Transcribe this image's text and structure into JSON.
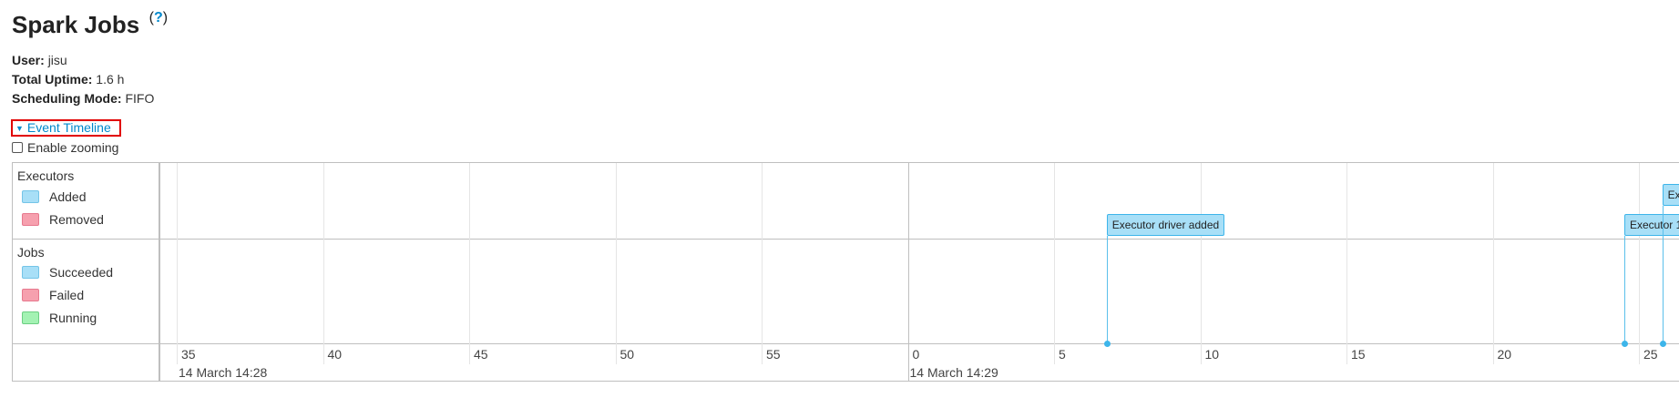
{
  "page": {
    "title": "Spark Jobs",
    "help_open": "(",
    "help_mark": "?",
    "help_close": ")"
  },
  "info": {
    "user_label": "User:",
    "user_value": "jisu",
    "uptime_label": "Total Uptime:",
    "uptime_value": "1.6 h",
    "scheduling_label": "Scheduling Mode:",
    "scheduling_value": "FIFO"
  },
  "timeline": {
    "toggle_label": "Event Timeline",
    "zoom_label": "Enable zooming",
    "executors_group": "Executors",
    "executors_items": [
      "Added",
      "Removed"
    ],
    "jobs_group": "Jobs",
    "jobs_items": [
      "Succeeded",
      "Failed",
      "Running"
    ],
    "tick_labels": [
      "35",
      "40",
      "45",
      "50",
      "55",
      "0",
      "5",
      "10",
      "15",
      "20",
      "25"
    ],
    "major_labels": [
      "14 March 14:28",
      "14 March 14:29"
    ],
    "events": [
      {
        "label": "Executor driver added",
        "time_seconds_after_14_29": 6.8
      },
      {
        "label": "Executor 1",
        "time_seconds_after_14_29": 24.5
      },
      {
        "label": "Exe",
        "time_seconds_after_14_29": 25.8
      }
    ]
  },
  "colors": {
    "link": "#0088cc",
    "highlight_border": "#e10000",
    "added": "#a8dff7",
    "removed": "#f6a0ae",
    "running": "#a3f2b3"
  }
}
